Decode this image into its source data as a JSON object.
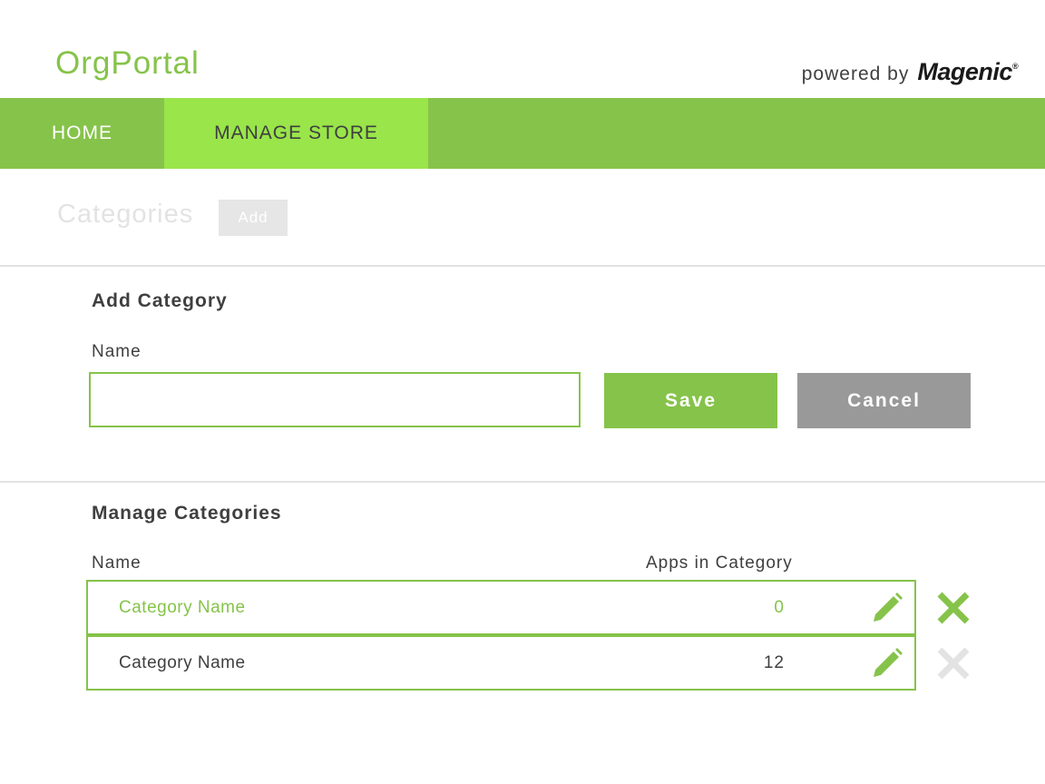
{
  "header": {
    "app_title": "OrgPortal",
    "powered_by": "powered by",
    "brand": "Magenic",
    "brand_mark": "®"
  },
  "nav": {
    "items": [
      {
        "label": "HOME",
        "active": false
      },
      {
        "label": "MANAGE STORE",
        "active": true
      }
    ]
  },
  "toolbar": {
    "title": "Categories",
    "add_label": "Add"
  },
  "add_category": {
    "heading": "Add Category",
    "name_label": "Name",
    "name_value": "",
    "save_label": "Save",
    "cancel_label": "Cancel"
  },
  "manage_categories": {
    "heading": "Manage Categories",
    "columns": [
      "Name",
      "Apps in Category"
    ],
    "rows": [
      {
        "name": "Category Name",
        "count": "0",
        "highlighted": true
      },
      {
        "name": "Category Name",
        "count": "12",
        "highlighted": false
      }
    ]
  },
  "icons": {
    "edit": "pencil-icon",
    "delete": "close-icon"
  },
  "colors": {
    "accent": "#86c34a",
    "accent_light": "#99e54a",
    "cancel": "#999999",
    "muted": "#e3e3e3",
    "text": "#3f3f3f"
  }
}
